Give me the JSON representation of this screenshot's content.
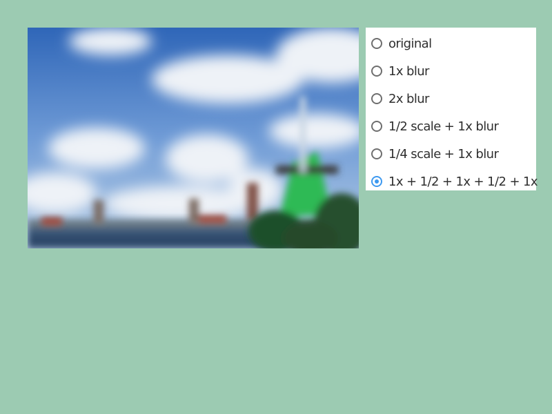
{
  "preview": {
    "icon": "blurred-windmill-photo"
  },
  "options": {
    "items": [
      {
        "label": "original",
        "selected": false
      },
      {
        "label": "1x blur",
        "selected": false
      },
      {
        "label": "2x blur",
        "selected": false
      },
      {
        "label": "1/2 scale + 1x blur",
        "selected": false
      },
      {
        "label": "1/4 scale + 1x blur",
        "selected": false
      },
      {
        "label": "1x + 1/2 + 1x + 1/2 + 1x",
        "selected": true
      }
    ],
    "accent_color": "#3d99f0"
  },
  "colors": {
    "background": "#9ccbb2",
    "panel": "#ffffff"
  }
}
